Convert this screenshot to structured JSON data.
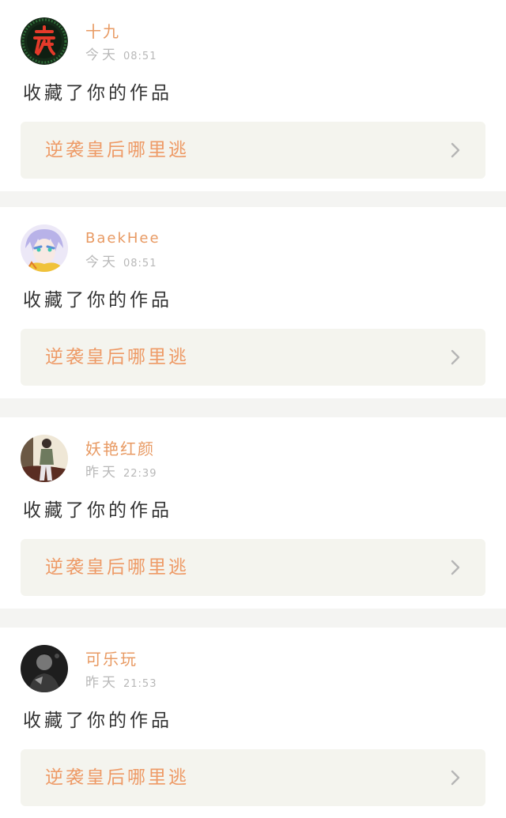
{
  "notifications": [
    {
      "username": "十九",
      "day": "今天",
      "time": "08:51",
      "action": "收藏了你的作品",
      "work_title": "逆袭皇后哪里逃",
      "avatar": {
        "icon": "night-character-avatar",
        "colors": [
          "#1f4f2a",
          "#e53a2a"
        ]
      }
    },
    {
      "username": "BaekHee",
      "day": "今天",
      "time": "08:51",
      "action": "收藏了你的作品",
      "work_title": "逆袭皇后哪里逃",
      "avatar": {
        "icon": "anime-character-avatar",
        "colors": [
          "#b8b2e8",
          "#f0c23a"
        ]
      }
    },
    {
      "username": "妖艳红颜",
      "day": "昨天",
      "time": "22:39",
      "action": "收藏了你的作品",
      "work_title": "逆袭皇后哪里逃",
      "avatar": {
        "icon": "person-photo-avatar",
        "colors": [
          "#efe7d6",
          "#6b5844"
        ]
      }
    },
    {
      "username": "可乐玩",
      "day": "昨天",
      "time": "21:53",
      "action": "收藏了你的作品",
      "work_title": "逆袭皇后哪里逃",
      "avatar": {
        "icon": "dark-photo-avatar",
        "colors": [
          "#1e1e1e",
          "#777777"
        ]
      }
    }
  ],
  "colors": {
    "username": "#e89a63",
    "work_title": "#ee9a66",
    "timestamp": "#b8b8b8",
    "action_text": "#333333",
    "link_background": "#f4f4ee",
    "page_background": "#f4f4f2"
  }
}
